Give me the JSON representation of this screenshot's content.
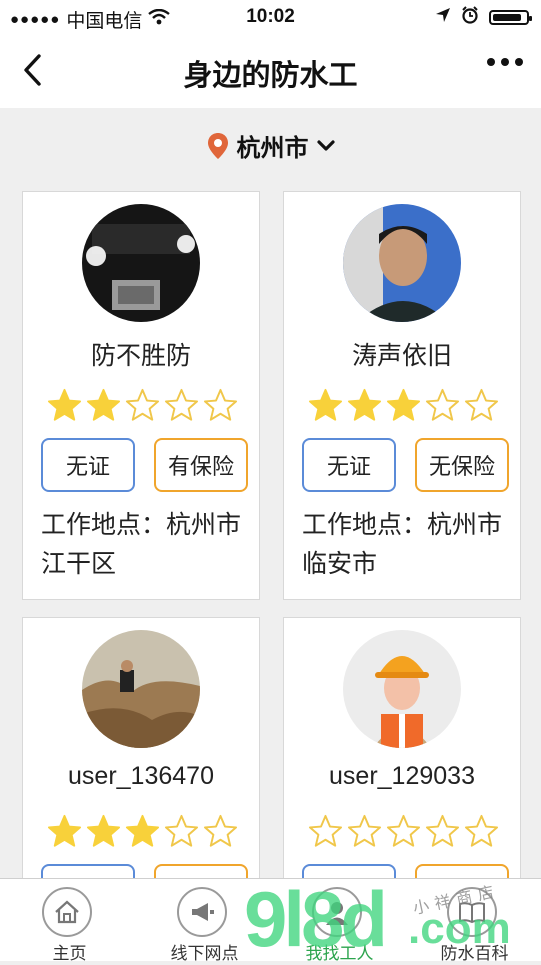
{
  "status": {
    "carrier": "中国电信",
    "time": "10:02"
  },
  "nav": {
    "title": "身边的防水工"
  },
  "city": {
    "name": "杭州市"
  },
  "workers": [
    {
      "name": "防不胜防",
      "rating": 2,
      "max_rating": 5,
      "cert": "无证",
      "insurance": "有保险",
      "location": "工作地点：杭州市江干区"
    },
    {
      "name": "涛声依旧",
      "rating": 3,
      "max_rating": 5,
      "cert": "无证",
      "insurance": "无保险",
      "location": "工作地点：杭州市临安市"
    },
    {
      "name": "user_136470",
      "rating": 3,
      "max_rating": 5,
      "cert": "",
      "insurance": "",
      "location": ""
    },
    {
      "name": "user_129033",
      "rating": 0,
      "max_rating": 5,
      "cert": "",
      "insurance": "",
      "location": ""
    }
  ],
  "tabs": [
    {
      "label": "主页",
      "icon": "home-icon"
    },
    {
      "label": "线下网点",
      "icon": "megaphone-icon"
    },
    {
      "label": "我找工人",
      "icon": "worker-icon",
      "active": true
    },
    {
      "label": "防水百科",
      "icon": "book-icon"
    }
  ],
  "watermark": {
    "big": "9l8d",
    "com": ".com",
    "small": "小祥商店"
  },
  "colors": {
    "star": "#f8d13a",
    "star_empty_stroke": "#f0c74a",
    "cert_border": "#5b8bd8",
    "insurance_border": "#f0a52c",
    "active_tab": "#2da44e",
    "location_pin": "#e0663a"
  }
}
